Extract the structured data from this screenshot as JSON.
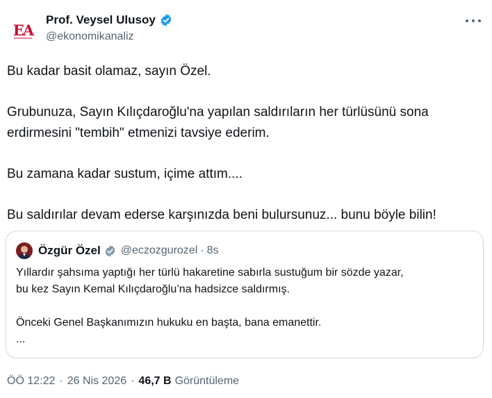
{
  "author": {
    "name": "Prof. Veysel Ulusoy",
    "handle": "@ekonomikanaliz",
    "logo_text": "EA",
    "logo_color": "#c8102e"
  },
  "tweet": {
    "paragraphs": [
      "Bu kadar basit olamaz, sayın Özel.",
      "Grubunuza, Sayın Kılıçdaroğlu'na yapılan saldırıların her türlüsünü sona erdirmesini \"tembih\" etmenizi tavsiye ederim.",
      "Bu zamana kadar sustum, içime attım....",
      "Bu saldırılar devam ederse karşınızda beni bulursunuz... bunu böyle bilin!"
    ]
  },
  "quote": {
    "name": "Özgür Özel",
    "handle": "@eczozgurozel",
    "separator": "·",
    "time": "8s",
    "lines": [
      "Yıllardır şahsıma yaptığı her türlü hakaretine sabırla sustuğum bir sözde yazar,",
      "bu kez Sayın Kemal Kılıçdaroğlu’na hadsizce saldırmış.",
      "Önceki Genel Başkanımızın hukuku en başta, bana emanettir.",
      "..."
    ]
  },
  "meta": {
    "time": "ÖÖ 12:22",
    "separator": "·",
    "date": "26 Nis 2026",
    "views_count": "46,7 B",
    "views_label": "Görüntüleme"
  },
  "colors": {
    "verified": "#1d9bf0",
    "secondary_text": "#536471",
    "border": "#cfd9de"
  },
  "icons": [
    "verified-badge-icon",
    "more-options-icon"
  ]
}
